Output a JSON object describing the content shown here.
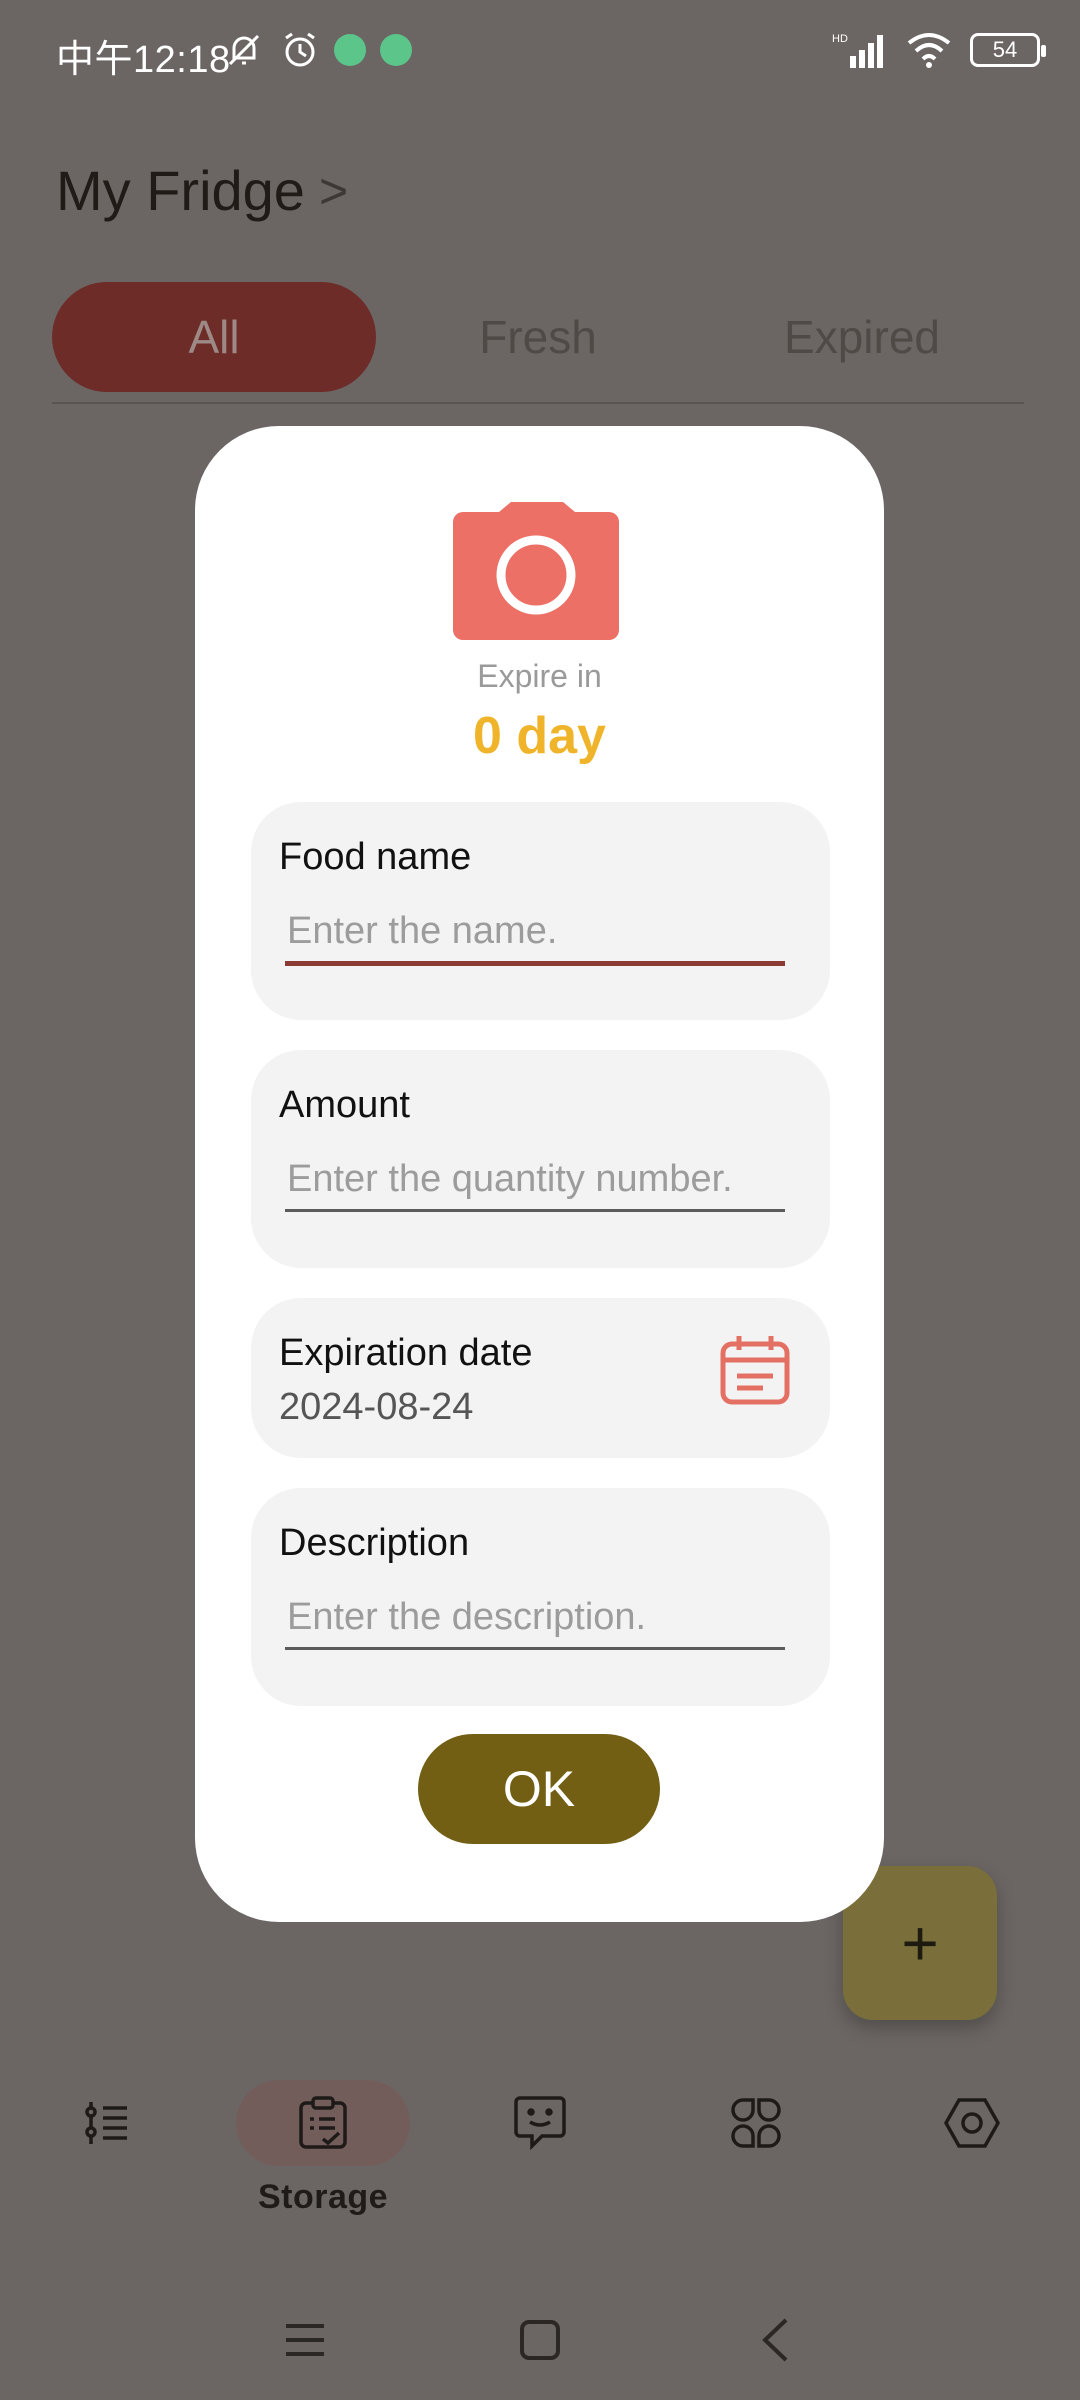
{
  "status_bar": {
    "time": "中午12:18",
    "battery": "54",
    "network_label": "HD",
    "icons": [
      "mute-bell-icon",
      "alarm-icon",
      "android-badge-icon",
      "wrench-badge-icon",
      "signal-icon",
      "wifi-icon",
      "battery-icon"
    ]
  },
  "header": {
    "title": "My Fridge",
    "chevron": ">"
  },
  "tabs": [
    {
      "label": "All",
      "active": true
    },
    {
      "label": "Fresh",
      "active": false
    },
    {
      "label": "Expired",
      "active": false
    }
  ],
  "dialog": {
    "photo_icon": "camera-icon",
    "expire_label": "Expire in",
    "expire_value": "0 day",
    "fields": {
      "name": {
        "label": "Food name",
        "placeholder": "Enter the name.",
        "value": ""
      },
      "amount": {
        "label": "Amount",
        "placeholder": "Enter the quantity number.",
        "value": ""
      },
      "expiration": {
        "label": "Expiration date",
        "value": "2024-08-24",
        "icon": "calendar-icon"
      },
      "description": {
        "label": "Description",
        "placeholder": "Enter the description.",
        "value": ""
      }
    },
    "ok_label": "OK"
  },
  "fab": {
    "label": "+"
  },
  "bottom_nav": [
    {
      "icon": "list-icon",
      "label": ""
    },
    {
      "icon": "clipboard-icon",
      "label": "Storage",
      "active": true
    },
    {
      "icon": "chat-icon",
      "label": ""
    },
    {
      "icon": "apps-icon",
      "label": ""
    },
    {
      "icon": "settings-icon",
      "label": ""
    }
  ],
  "system_nav": [
    "menu-icon",
    "home-icon",
    "back-icon"
  ],
  "colors": {
    "accent": "#725f14",
    "camera": "#ec7066",
    "expire_value": "#f0b42a",
    "tab_active": "#6e2c28",
    "overlay_bg": "#6b6663"
  }
}
